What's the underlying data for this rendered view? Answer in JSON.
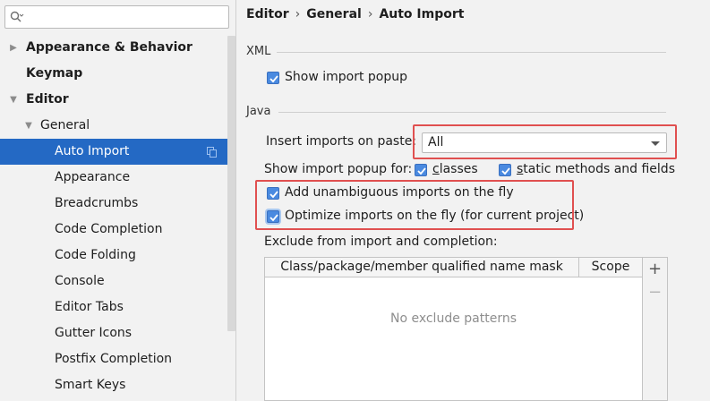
{
  "search": {
    "value": ""
  },
  "sidebar": {
    "items": [
      {
        "label": "Appearance & Behavior",
        "level": 0,
        "arrow": "right",
        "bold": true
      },
      {
        "label": "Keymap",
        "level": 0,
        "arrow": "",
        "bold": true
      },
      {
        "label": "Editor",
        "level": 0,
        "arrow": "down",
        "bold": true
      },
      {
        "label": "General",
        "level": 1,
        "arrow": "down",
        "bold": false
      },
      {
        "label": "Auto Import",
        "level": 2,
        "arrow": "",
        "bold": false,
        "selected": true
      },
      {
        "label": "Appearance",
        "level": 2,
        "arrow": "",
        "bold": false
      },
      {
        "label": "Breadcrumbs",
        "level": 2,
        "arrow": "",
        "bold": false
      },
      {
        "label": "Code Completion",
        "level": 2,
        "arrow": "",
        "bold": false
      },
      {
        "label": "Code Folding",
        "level": 2,
        "arrow": "",
        "bold": false
      },
      {
        "label": "Console",
        "level": 2,
        "arrow": "",
        "bold": false
      },
      {
        "label": "Editor Tabs",
        "level": 2,
        "arrow": "",
        "bold": false
      },
      {
        "label": "Gutter Icons",
        "level": 2,
        "arrow": "",
        "bold": false
      },
      {
        "label": "Postfix Completion",
        "level": 2,
        "arrow": "",
        "bold": false
      },
      {
        "label": "Smart Keys",
        "level": 2,
        "arrow": "",
        "bold": false
      }
    ]
  },
  "breadcrumb": {
    "part1": "Editor",
    "part2": "General",
    "part3": "Auto Import",
    "separator": "›"
  },
  "xml": {
    "title": "XML",
    "show_import_popup": {
      "label": "Show import popup",
      "checked": true
    }
  },
  "java": {
    "title": "Java",
    "insert_imports_label": "Insert imports on paste:",
    "insert_imports_value": "All",
    "show_popup_for_label": "Show import popup for:",
    "classes": {
      "label": "classes",
      "checked": true
    },
    "static_methods": {
      "label": "static methods and fields",
      "checked": true
    },
    "add_unambiguous": {
      "label": "Add unambiguous imports on the fly",
      "checked": true
    },
    "optimize_imports": {
      "label": "Optimize imports on the fly (for current project)",
      "checked": true
    },
    "exclude_label": "Exclude from import and completion:",
    "table": {
      "columns": [
        "Class/package/member qualified name mask",
        "Scope"
      ],
      "empty_text": "No exclude patterns"
    },
    "add_button": "+",
    "remove_button": "−"
  },
  "colors": {
    "selection": "#2469c4",
    "highlight": "#e05050",
    "checkbox": "#4a8ae0"
  }
}
